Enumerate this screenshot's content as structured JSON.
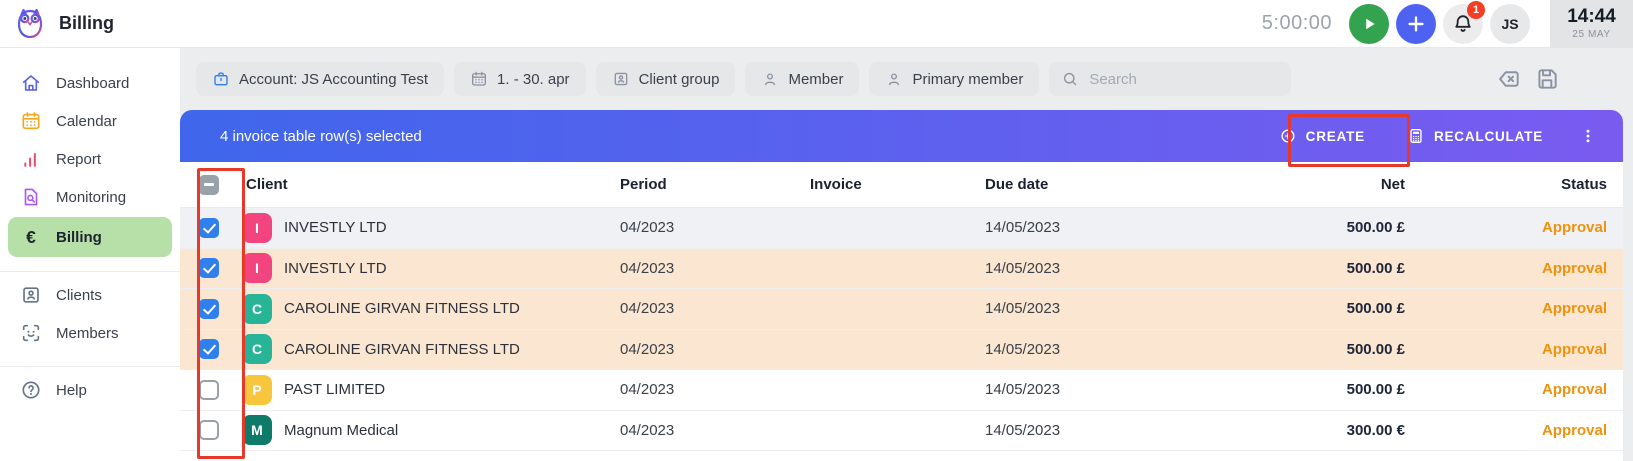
{
  "header": {
    "title": "Billing",
    "timer": "5:00:00",
    "notification_count": "1",
    "avatar_initials": "JS",
    "clock": {
      "time": "14:44",
      "date": "25 MAY"
    }
  },
  "sidebar": {
    "selected_bg": "#b7e0a8",
    "items": [
      {
        "label": "Dashboard",
        "icon": "home-icon",
        "color": "#5c63e9"
      },
      {
        "label": "Calendar",
        "icon": "calendar-icon",
        "color": "#f6a722"
      },
      {
        "label": "Report",
        "icon": "report-icon",
        "color": "#f4486c"
      },
      {
        "label": "Monitoring",
        "icon": "monitoring-icon",
        "color": "#a958f5"
      },
      {
        "label": "Billing",
        "icon": "euro-icon",
        "color": "#1d2430",
        "selected": true
      },
      {
        "label": "Clients",
        "icon": "clients-icon",
        "color": "#64748b",
        "divider_before": true
      },
      {
        "label": "Members",
        "icon": "members-icon",
        "color": "#64748b"
      },
      {
        "label": "Help",
        "icon": "help-icon",
        "color": "#64748b",
        "divider_before": true
      }
    ]
  },
  "filters": {
    "chips": [
      {
        "label": "Account: JS Accounting Test",
        "icon": "briefcase-icon",
        "icon_color": "#2f7bf0"
      },
      {
        "label": "1. - 30. apr",
        "icon": "calendar-icon",
        "icon_color": "#8a93a0"
      },
      {
        "label": "Client group",
        "icon": "badge-icon",
        "icon_color": "#8a93a0"
      },
      {
        "label": "Member",
        "icon": "person-icon",
        "icon_color": "#8a93a0"
      },
      {
        "label": "Primary member",
        "icon": "person-icon",
        "icon_color": "#8a93a0"
      }
    ],
    "search_placeholder": "Search"
  },
  "selection_bar": {
    "text": "4 invoice table row(s) selected",
    "create_label": "CREATE",
    "recalculate_label": "RECALCULATE",
    "gradient": [
      "#3f66ec",
      "#7a5bf0"
    ]
  },
  "table": {
    "columns": [
      "Client",
      "Period",
      "Invoice",
      "Due date",
      "Net",
      "Status"
    ],
    "status_color": "#f0920e",
    "rows": [
      {
        "checked": true,
        "initial": "I",
        "avatar_color": "#f2447e",
        "client": "INVESTLY LTD",
        "period": "04/2023",
        "invoice": "",
        "due_date": "14/05/2023",
        "net": "500.00 £",
        "status": "Approval",
        "row_bg": "#eff1f4"
      },
      {
        "checked": true,
        "initial": "I",
        "avatar_color": "#f2447e",
        "client": "INVESTLY LTD",
        "period": "04/2023",
        "invoice": "",
        "due_date": "14/05/2023",
        "net": "500.00 £",
        "status": "Approval",
        "row_bg": "#fbe7d1"
      },
      {
        "checked": true,
        "initial": "C",
        "avatar_color": "#28b597",
        "client": "CAROLINE GIRVAN FITNESS LTD",
        "period": "04/2023",
        "invoice": "",
        "due_date": "14/05/2023",
        "net": "500.00 £",
        "status": "Approval",
        "row_bg": "#fbe7d1"
      },
      {
        "checked": true,
        "initial": "C",
        "avatar_color": "#28b597",
        "client": "CAROLINE GIRVAN FITNESS LTD",
        "period": "04/2023",
        "invoice": "",
        "due_date": "14/05/2023",
        "net": "500.00 £",
        "status": "Approval",
        "row_bg": "#fbe7d1"
      },
      {
        "checked": false,
        "initial": "P",
        "avatar_color": "#f8c63d",
        "client": "PAST LIMITED",
        "period": "04/2023",
        "invoice": "",
        "due_date": "14/05/2023",
        "net": "500.00 £",
        "status": "Approval",
        "row_bg": "#ffffff"
      },
      {
        "checked": false,
        "initial": "M",
        "avatar_color": "#0e7a6a",
        "client": "Magnum Medical",
        "period": "04/2023",
        "invoice": "",
        "due_date": "14/05/2023",
        "net": "300.00 €",
        "status": "Approval",
        "row_bg": "#ffffff"
      }
    ]
  },
  "annotations": {
    "color": "#e7382c",
    "targets": [
      "checkbox-column",
      "create-button"
    ]
  }
}
